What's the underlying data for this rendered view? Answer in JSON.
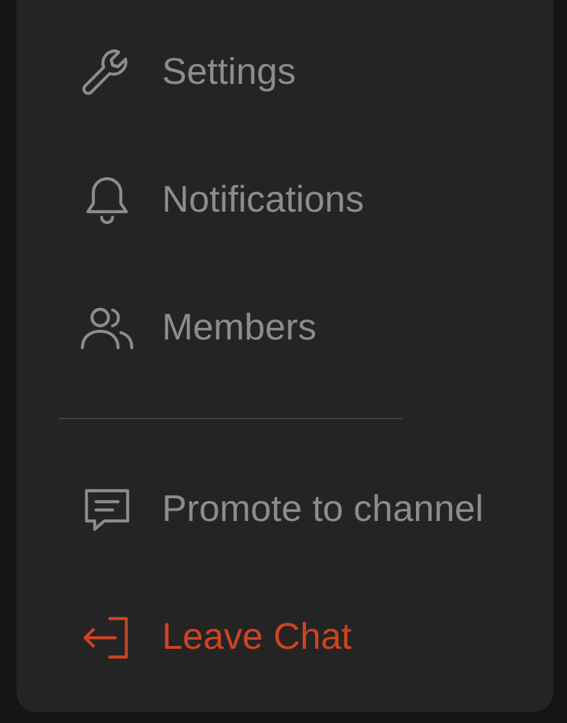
{
  "menu": {
    "items": [
      {
        "kind": "item",
        "label": "Settings"
      },
      {
        "kind": "item",
        "label": "Notifications"
      },
      {
        "kind": "item",
        "label": "Members"
      },
      {
        "kind": "divider"
      },
      {
        "kind": "item",
        "label": "Promote to channel"
      },
      {
        "kind": "danger",
        "label": "Leave Chat"
      }
    ]
  }
}
